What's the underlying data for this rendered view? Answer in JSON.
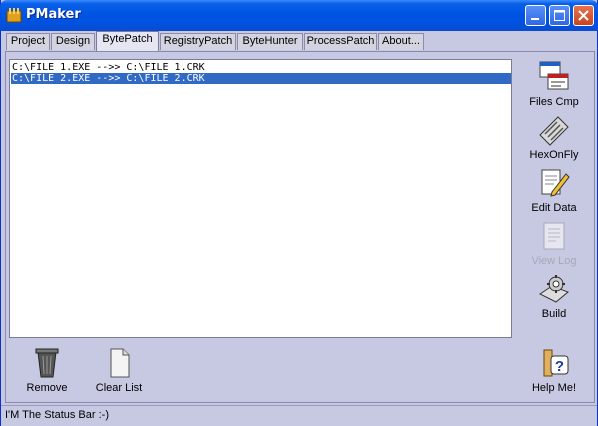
{
  "window": {
    "title": "PMaker"
  },
  "tabs": [
    {
      "label": "Project"
    },
    {
      "label": "Design"
    },
    {
      "label": "BytePatch",
      "active": true
    },
    {
      "label": "RegistryPatch"
    },
    {
      "label": "ByteHunter"
    },
    {
      "label": "ProcessPatch"
    },
    {
      "label": "About..."
    }
  ],
  "list": {
    "items": [
      {
        "text": "C:\\FILE 1.EXE -->> C:\\FILE 1.CRK",
        "selected": false
      },
      {
        "text": "C:\\FILE 2.EXE -->> C:\\FILE 2.CRK",
        "selected": true
      }
    ]
  },
  "toolbar": {
    "files_cmp": "Files Cmp",
    "hexonfly": "HexOnFly",
    "edit_data": "Edit Data",
    "view_log": "View Log",
    "build": "Build"
  },
  "bottom": {
    "remove": "Remove",
    "clear_list": "Clear List",
    "help": "Help Me!"
  },
  "status": {
    "text": "I'M The Status Bar  :-)"
  },
  "colors": {
    "titlebar": "#0054e3",
    "window_bg": "#c7c8e2",
    "selection": "#316ac5"
  }
}
